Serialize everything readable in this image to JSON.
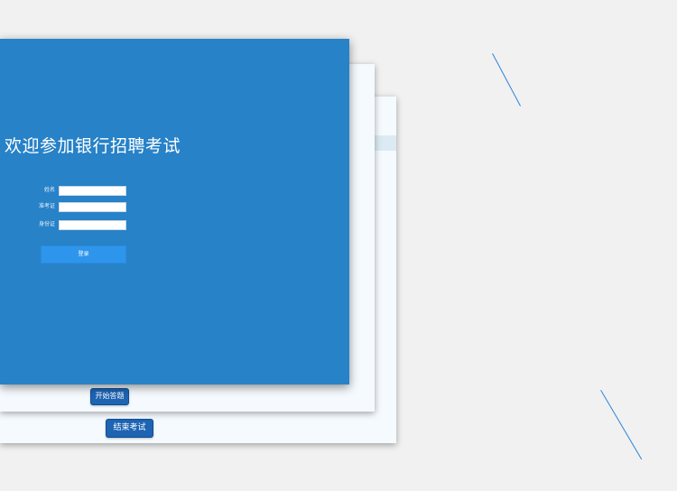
{
  "welcome_title": "欢迎参加银行招聘考试",
  "login_form": {
    "fields": [
      {
        "label": "姓名",
        "value": ""
      },
      {
        "label": "准考证",
        "value": ""
      },
      {
        "label": "身份证",
        "value": ""
      }
    ],
    "submit_label": "登录"
  },
  "exam_window": {
    "start_answer_label": "开始答题"
  },
  "back_window": {
    "finish_exam_label": "结束考试"
  },
  "colors": {
    "login_panel": "#2782c8",
    "primary_button": "#1d64b3",
    "login_button": "#2e95ec",
    "background": "#f1f1f1"
  }
}
